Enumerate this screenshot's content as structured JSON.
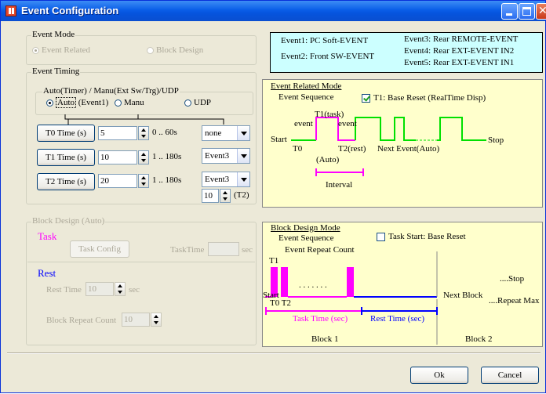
{
  "window": {
    "title": "Event Configuration"
  },
  "event_mode": {
    "label": "Event Mode",
    "option1": "Event Related",
    "option2": "Block Design"
  },
  "info": {
    "l1": "Event1: PC Soft-EVENT",
    "l2": "Event2: Front SW-EVENT",
    "r1": "Event3: Rear REMOTE-EVENT",
    "r2": "Event4: Rear EXT-EVENT IN2",
    "r3": "Event5: Rear EXT-EVENT IN1"
  },
  "event_timing": {
    "label": "Event Timing",
    "sub_label": "Auto(Timer) / Manu(Ext Sw/Trg)/UDP",
    "auto": "Auto",
    "auto_note": "(Event1)",
    "manu": "Manu",
    "udp": "UDP",
    "t0_button": "T0 Time (s)",
    "t0_value": "5",
    "t0_range": "0 .. 60s",
    "t0_select": "none",
    "t1_button": "T1 Time (s)",
    "t1_value": "10",
    "t1_range": "1 .. 180s",
    "t1_select": "Event3",
    "t2_button": "T2 Time (s)",
    "t2_value": "20",
    "t2_range": "1 .. 180s",
    "t2_select": "Event3",
    "t2_count": "10",
    "t2_count_note": "(T2)"
  },
  "block_design": {
    "label": "Block Design (Auto)",
    "task_label": "Task",
    "task_config": "Task Config",
    "task_time_label": "TaskTime",
    "task_time_unit": "sec",
    "rest_label": "Rest",
    "rest_time_label": "Rest Time",
    "rest_time_value": "10",
    "rest_time_unit": "sec",
    "repeat_label": "Block Repeat Count",
    "repeat_value": "10"
  },
  "event_diagram": {
    "title": "Event Related Mode",
    "sequence": "Event Sequence",
    "checkbox": "T1: Base Reset (RealTime Disp)",
    "t1task": "T1(task)",
    "event_a": "event",
    "event_b": "event",
    "start": "Start",
    "t0": "T0",
    "t2rest": "T2(rest)",
    "next": "Next Event(Auto)",
    "auto": "(Auto)",
    "stop": "Stop",
    "interval": "Interval"
  },
  "block_diagram": {
    "title": "Block Design Mode",
    "sequence": "Event Sequence",
    "checkbox": "Task Start: Base Reset",
    "repeat": "Event Repeat Count",
    "t1": "T1",
    "dots": ". . . . . . .",
    "start": "Start",
    "t0t2": "T0 T2",
    "next_block": "Next Block",
    "stop": "....Stop",
    "repeat_max": "....Repeat Max",
    "task_time": "Task Time (sec)",
    "rest_time": "Rest Time (sec)",
    "block1": "Block 1",
    "block2": "Block 2"
  },
  "buttons": {
    "ok": "Ok",
    "cancel": "Cancel"
  },
  "colors": {
    "green": "#00e000",
    "magenta": "#ff00ff",
    "blue": "#0000ff",
    "titlebar": "#0a5ee8"
  }
}
